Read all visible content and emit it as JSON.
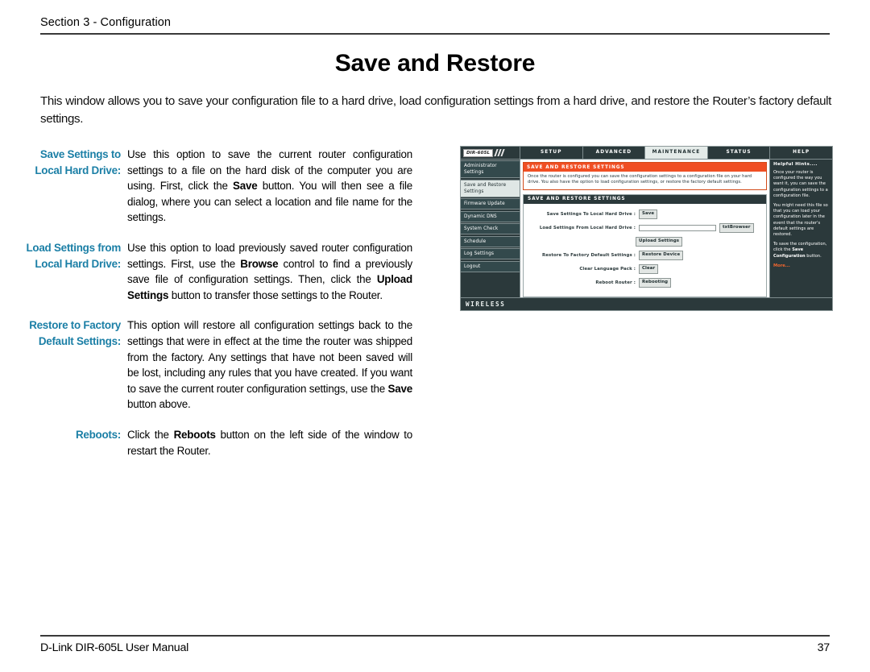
{
  "header": {
    "section_label": "Section 3 - Configuration"
  },
  "title": "Save and Restore",
  "intro": "This window allows you to save your configuration file to a hard drive, load configuration settings from a hard drive, and restore the Router’s factory default settings.",
  "definitions": [
    {
      "term": "Save Settings to Local Hard Drive:",
      "parts": [
        {
          "text": "Use this option to save the current router configuration settings to a file on the hard disk of the computer you are using. First, click the "
        },
        {
          "text": "Save",
          "bold": true
        },
        {
          "text": " button. You will then see a file dialog, where you can select a location and file name for the settings."
        }
      ]
    },
    {
      "term": "Load Settings from Local Hard Drive:",
      "parts": [
        {
          "text": "Use this option to load previously saved router configuration settings. First, use the "
        },
        {
          "text": "Browse",
          "bold": true
        },
        {
          "text": " control to find a previously save file of configuration settings. Then, click the "
        },
        {
          "text": "Upload Settings",
          "bold": true
        },
        {
          "text": " button to transfer those settings to the Router."
        }
      ]
    },
    {
      "term": "Restore to Factory Default Settings:",
      "parts": [
        {
          "text": "This option will restore all configuration settings back to the settings that were in effect at the time the router was shipped from the factory. Any settings that have not been saved will be lost, including any rules that you have created. If you want to save the current router configuration settings, use the "
        },
        {
          "text": "Save",
          "bold": true
        },
        {
          "text": " button above."
        }
      ]
    },
    {
      "term": "Reboots:",
      "parts": [
        {
          "text": "Click the "
        },
        {
          "text": "Reboots",
          "bold": true
        },
        {
          "text": " button on the left side of the window to restart the Router."
        }
      ]
    }
  ],
  "router_ui": {
    "logo": "DIR-605L",
    "nav_tabs": [
      {
        "label": "SETUP",
        "active": false
      },
      {
        "label": "ADVANCED",
        "active": false
      },
      {
        "label": "MAINTENANCE",
        "active": true
      },
      {
        "label": "STATUS",
        "active": false
      },
      {
        "label": "HELP",
        "active": false
      }
    ],
    "sidebar": [
      {
        "label": "Administrator Settings",
        "selected": false
      },
      {
        "label": "Save and Restore Settings",
        "selected": true
      },
      {
        "label": "Firmware Update",
        "selected": false
      },
      {
        "label": "Dynamic DNS",
        "selected": false
      },
      {
        "label": "System Check",
        "selected": false
      },
      {
        "label": "Schedule",
        "selected": false
      },
      {
        "label": "Log Settings",
        "selected": false
      },
      {
        "label": "Logout",
        "selected": false
      }
    ],
    "alert": {
      "title": "SAVE AND RESTORE SETTINGS",
      "body": "Once the router is configured you can save the configuration settings to a configuration file on your hard drive. You also have the option to load configuration settings, or restore the factory default settings."
    },
    "panel": {
      "title": "SAVE AND RESTORE SETTINGS",
      "rows": [
        {
          "label": "Save Settings To Local Hard Drive :",
          "button": "Save",
          "type": "button"
        },
        {
          "label": "Load Settings From Local Hard Drive :",
          "input_value": "",
          "button": "txtBrowser",
          "type": "file"
        },
        {
          "label": "",
          "button": "Upload Settings",
          "type": "indent-button"
        },
        {
          "label": "Restore To Factory Default Settings :",
          "button": "Restore Device",
          "type": "button"
        },
        {
          "label": "Clear Language Pack :",
          "button": "Clear",
          "type": "button"
        },
        {
          "label": "Reboot Router :",
          "button": "Rebooting",
          "type": "button"
        }
      ]
    },
    "hints": {
      "title": "Helpful Hints....",
      "paragraph1": "Once your router is configured the way you want it, you can save the configuration settings to a configuration file.",
      "paragraph2": "You might need this file so that you can load your configuration later in the event that the router's default settings are restored.",
      "paragraph3_pre": "To save the configuration, click the ",
      "paragraph3_bold": "Save Configuration",
      "paragraph3_post": " button.",
      "more": "More..."
    },
    "wireless_bar": "WIRELESS"
  },
  "footer": {
    "manual": "D-Link DIR-605L User Manual",
    "page_number": "37"
  },
  "colors": {
    "term_teal": "#1b7fa6",
    "router_dark": "#2b393b",
    "alert_orange": "#f04e23",
    "hint_more": "#f0662f"
  }
}
